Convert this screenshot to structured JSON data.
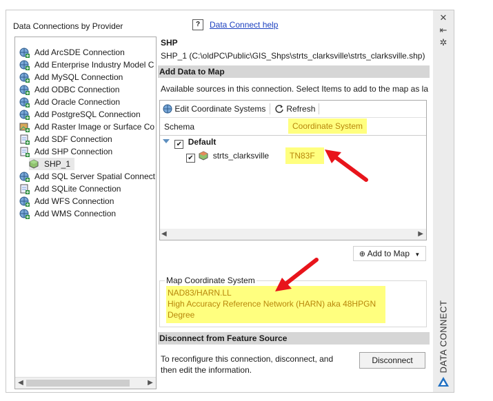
{
  "left_panel": {
    "title": "Data Connections by Provider",
    "items": [
      {
        "label": "Add ArcSDE Connection",
        "icon": "globe-add-icon"
      },
      {
        "label": "Add Enterprise Industry Model C",
        "icon": "globe-add-icon"
      },
      {
        "label": "Add MySQL Connection",
        "icon": "globe-add-icon"
      },
      {
        "label": "Add ODBC Connection",
        "icon": "globe-add-icon"
      },
      {
        "label": "Add Oracle Connection",
        "icon": "globe-add-icon"
      },
      {
        "label": "Add PostgreSQL Connection",
        "icon": "globe-add-icon"
      },
      {
        "label": "Add Raster Image or Surface Co",
        "icon": "raster-add-icon"
      },
      {
        "label": "Add SDF Connection",
        "icon": "file-add-icon"
      },
      {
        "label": "Add SHP Connection",
        "icon": "file-add-icon"
      },
      {
        "label": "SHP_1",
        "icon": "cube-icon"
      },
      {
        "label": "Add SQL Server Spatial Connect",
        "icon": "globe-add-icon"
      },
      {
        "label": "Add SQLite Connection",
        "icon": "file-add-icon"
      },
      {
        "label": "Add WFS Connection",
        "icon": "globe-add-icon"
      },
      {
        "label": "Add WMS Connection",
        "icon": "globe-add-icon"
      }
    ]
  },
  "help": {
    "icon_label": "?",
    "link": "Data Connect help"
  },
  "connection": {
    "name": "SHP",
    "path": "SHP_1 (C:\\oldPC\\Public\\GIS_Shps\\strts_clarksville\\strts_clarksville.shp)"
  },
  "add_data": {
    "section_title": "Add Data to Map",
    "description": "Available sources in this connection.  Select Items to add to the map as la",
    "toolbar": {
      "edit_cs": "Edit Coordinate Systems",
      "refresh": "Refresh"
    },
    "columns": {
      "schema": "Schema",
      "coord": "Coordinate System"
    },
    "schema_group": "Default",
    "feature": {
      "name": "strts_clarksville",
      "coord": "TN83F",
      "checked": true
    },
    "add_to_map": "Add to Map"
  },
  "map_cs": {
    "legend": "Map Coordinate System",
    "code": "NAD83/HARN.LL",
    "desc1": "High Accuracy Reference Network (HARN) aka 48HPGN",
    "desc2": "Degree"
  },
  "disconnect": {
    "section_title": "Disconnect from Feature Source",
    "text1": "To reconfigure this connection, disconnect, and",
    "text2": "then edit the information.",
    "button": "Disconnect"
  },
  "palette": {
    "title": "DATA CONNECT"
  },
  "colors": {
    "highlight": "#ffff7f",
    "arrow": "#e8141b",
    "link": "#1a3fbf",
    "section_bar": "#d6d6d6"
  }
}
